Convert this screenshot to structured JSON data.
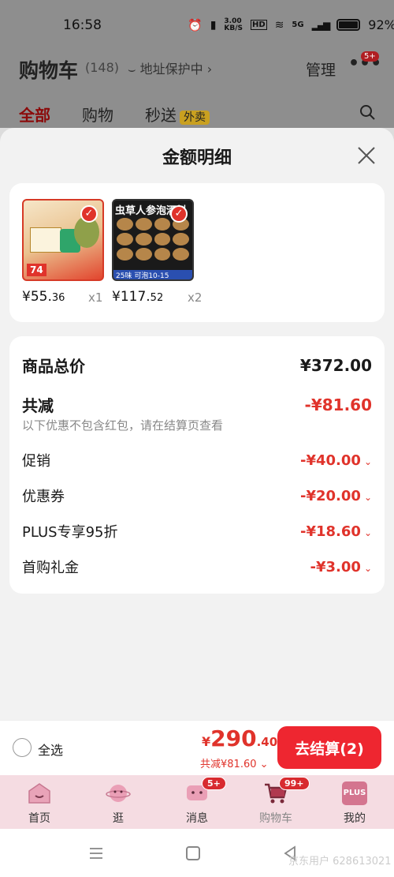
{
  "status_bar": {
    "time": "16:58",
    "net_speed": "3.00\nKB/S",
    "hd": "HD",
    "signal": "5G",
    "battery": "92%"
  },
  "header": {
    "title": "购物车",
    "count": "(148)",
    "address_protect": "地址保护中 ›",
    "manage": "管理",
    "more_badge": "5+"
  },
  "tabs": [
    {
      "label": "全部"
    },
    {
      "label": "购物"
    },
    {
      "label": "秒送",
      "badge": "外卖"
    }
  ],
  "sheet": {
    "title": "金额明细",
    "products": [
      {
        "price_int": "¥55.",
        "price_dec": "36",
        "qty": "x1",
        "tag": "74"
      },
      {
        "price_int": "¥117.",
        "price_dec": "52",
        "qty": "x2",
        "title": "虫草人参泡酒料",
        "footer": "25味 可泡10-15"
      }
    ],
    "details": {
      "total_label": "商品总价",
      "total_value": "¥372.00",
      "reduce_label": "共减",
      "reduce_value": "-¥81.60",
      "reduce_note": "以下优惠不包含红包，请在结算页查看",
      "items": [
        {
          "label": "促销",
          "value": "-¥40.00"
        },
        {
          "label": "优惠券",
          "value": "-¥20.00"
        },
        {
          "label": "PLUS专享95折",
          "value": "-¥18.60"
        },
        {
          "label": "首购礼金",
          "value": "-¥3.00"
        }
      ]
    }
  },
  "bottom_bar": {
    "select_all": "全选",
    "price_yen": "¥",
    "price_int": "290",
    "price_dec": ".40",
    "reduce": "共减¥81.60 ⌄",
    "checkout": "去结算(2)"
  },
  "tabbar": [
    {
      "label": "首页"
    },
    {
      "label": "逛"
    },
    {
      "label": "消息",
      "badge": "5+"
    },
    {
      "label": "购物车",
      "badge": "99+"
    },
    {
      "label": "我的",
      "icon_text": "PLUS"
    }
  ],
  "watermark": "京东用户 628613021",
  "colors": {
    "accent": "#e0332b",
    "checkout": "#ee2630",
    "tabbar_bg": "#f5dce2"
  }
}
